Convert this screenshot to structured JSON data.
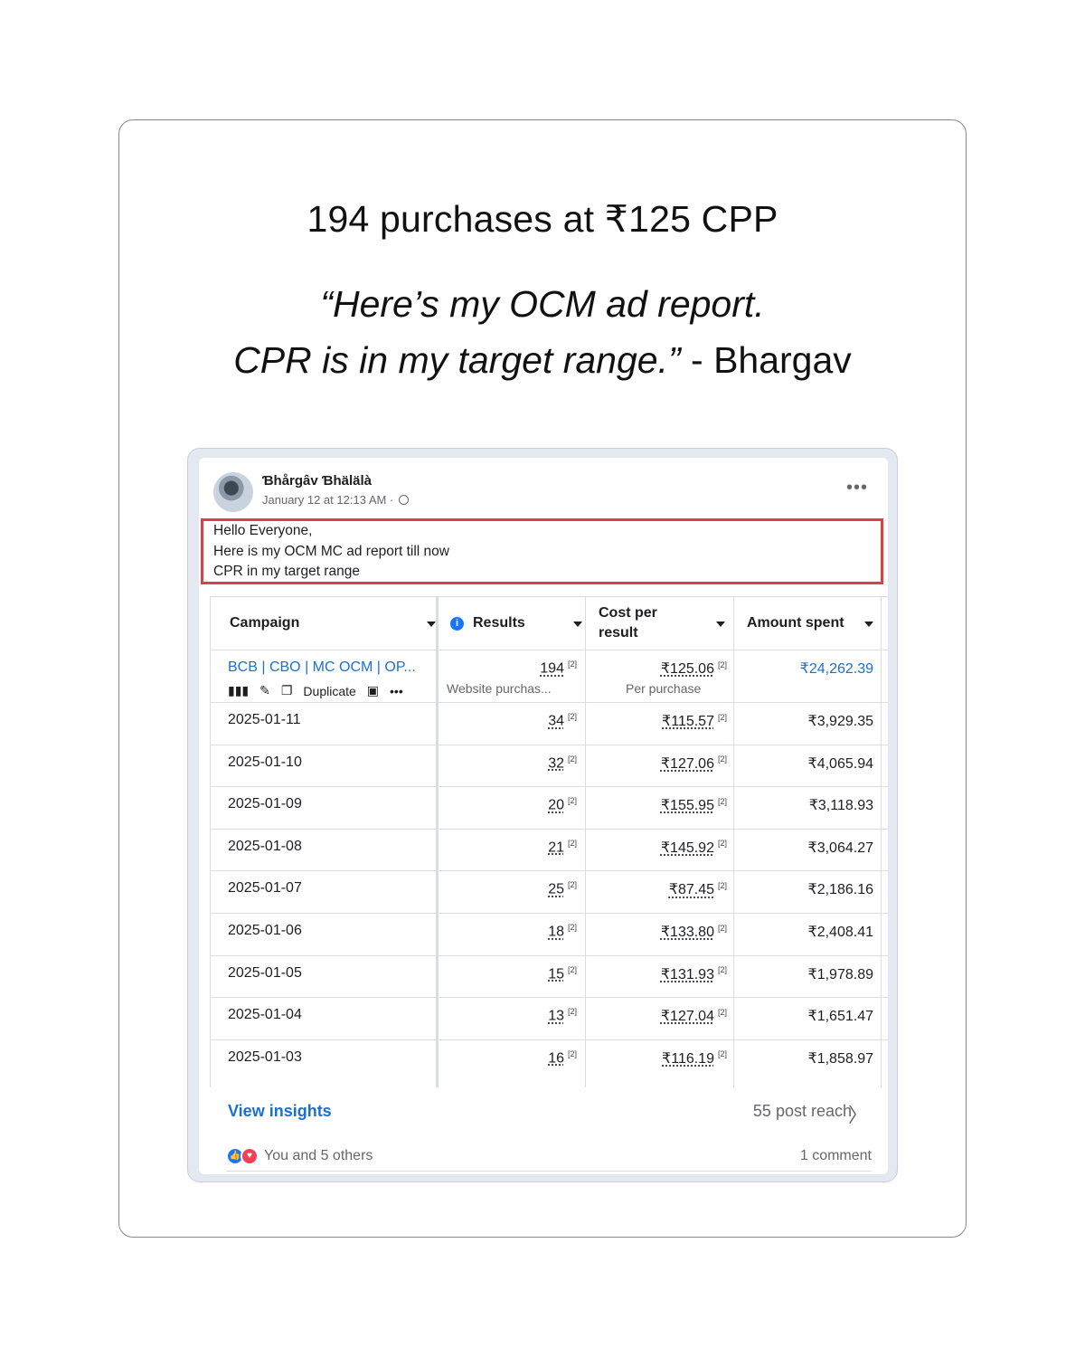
{
  "headline": "194 purchases at ₹125 CPP",
  "quote": {
    "line1": "“Here’s my OCM ad report.",
    "line2_italic": "CPR is in my target range.”",
    "line2_author": " - Bhargav"
  },
  "post": {
    "author": "Ɓhårgâv Ɓhälälà",
    "timestamp": "January 12 at 12:13 AM ·",
    "more_icon": "•••",
    "message": {
      "line1": "Hello Everyone,",
      "line2": "Here is my OCM MC ad report till now",
      "line3": "CPR in my target range"
    }
  },
  "table": {
    "headers": {
      "campaign": "Campaign",
      "results": "Results",
      "cost_line1": "Cost per",
      "cost_line2": "result",
      "amount": "Amount spent"
    },
    "summary": {
      "name": "BCB | CBO | MC OCM | OP...",
      "duplicate": "Duplicate",
      "results": "194",
      "results_sub": "Website purchas...",
      "cost": "₹125.06",
      "cost_sub": "Per purchase",
      "amount": "₹24,262.39",
      "note": "[2]"
    },
    "rows": [
      {
        "date": "2025-01-11",
        "results": "34",
        "cost": "₹115.57",
        "amount": "₹3,929.35"
      },
      {
        "date": "2025-01-10",
        "results": "32",
        "cost": "₹127.06",
        "amount": "₹4,065.94"
      },
      {
        "date": "2025-01-09",
        "results": "20",
        "cost": "₹155.95",
        "amount": "₹3,118.93"
      },
      {
        "date": "2025-01-08",
        "results": "21",
        "cost": "₹145.92",
        "amount": "₹3,064.27"
      },
      {
        "date": "2025-01-07",
        "results": "25",
        "cost": "₹87.45",
        "amount": "₹2,186.16"
      },
      {
        "date": "2025-01-06",
        "results": "18",
        "cost": "₹133.80",
        "amount": "₹2,408.41"
      },
      {
        "date": "2025-01-05",
        "results": "15",
        "cost": "₹131.93",
        "amount": "₹1,978.89"
      },
      {
        "date": "2025-01-04",
        "results": "13",
        "cost": "₹127.04",
        "amount": "₹1,651.47"
      },
      {
        "date": "2025-01-03",
        "results": "16",
        "cost": "₹116.19",
        "amount": "₹1,858.97"
      }
    ]
  },
  "footer": {
    "view_insights": "View insights",
    "reach": "55 post reach",
    "reactions": "You and 5 others",
    "comments": "1 comment"
  },
  "colors": {
    "link_blue": "#1a6fd6",
    "highlight_red": "#d64545",
    "like_blue": "#1877f2",
    "love_red": "#f33e58"
  }
}
